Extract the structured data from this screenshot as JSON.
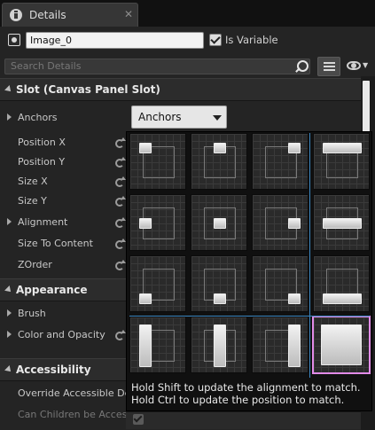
{
  "tab": {
    "title": "Details",
    "close": "✕"
  },
  "header": {
    "name_value": "Image_0",
    "is_variable_label": "Is Variable",
    "is_variable_checked": true,
    "search_placeholder": "Search Details"
  },
  "slot_category": {
    "title": "Slot (Canvas Panel Slot)",
    "props": [
      "Anchors",
      "Position X",
      "Position Y",
      "Size X",
      "Size Y",
      "Alignment",
      "Size To Content",
      "ZOrder"
    ]
  },
  "anchors_dropdown": {
    "value": "Anchors"
  },
  "appearance_category": {
    "title": "Appearance",
    "props": [
      "Brush",
      "Color and Opacity"
    ]
  },
  "accessibility_category": {
    "title": "Accessibility",
    "props": [
      "Override Accessible Def",
      "Can Children be Accessib"
    ]
  },
  "anchor_popup": {
    "hint_line1": "Hold Shift to update the alignment to match.",
    "hint_line2": "Hold Ctrl to update the position to match.",
    "presets": [
      "top-left",
      "top-center",
      "top-right",
      "top-stretch",
      "center-left",
      "center",
      "center-right",
      "center-stretch",
      "bottom-left",
      "bottom-center",
      "bottom-right",
      "bottom-stretch",
      "left-stretch",
      "center-vstretch",
      "right-stretch",
      "full-stretch"
    ],
    "selected": "full-stretch"
  },
  "colors": {
    "panel_bg": "#242424",
    "selection": "#e28be8",
    "guide_line": "#3b86c0"
  }
}
